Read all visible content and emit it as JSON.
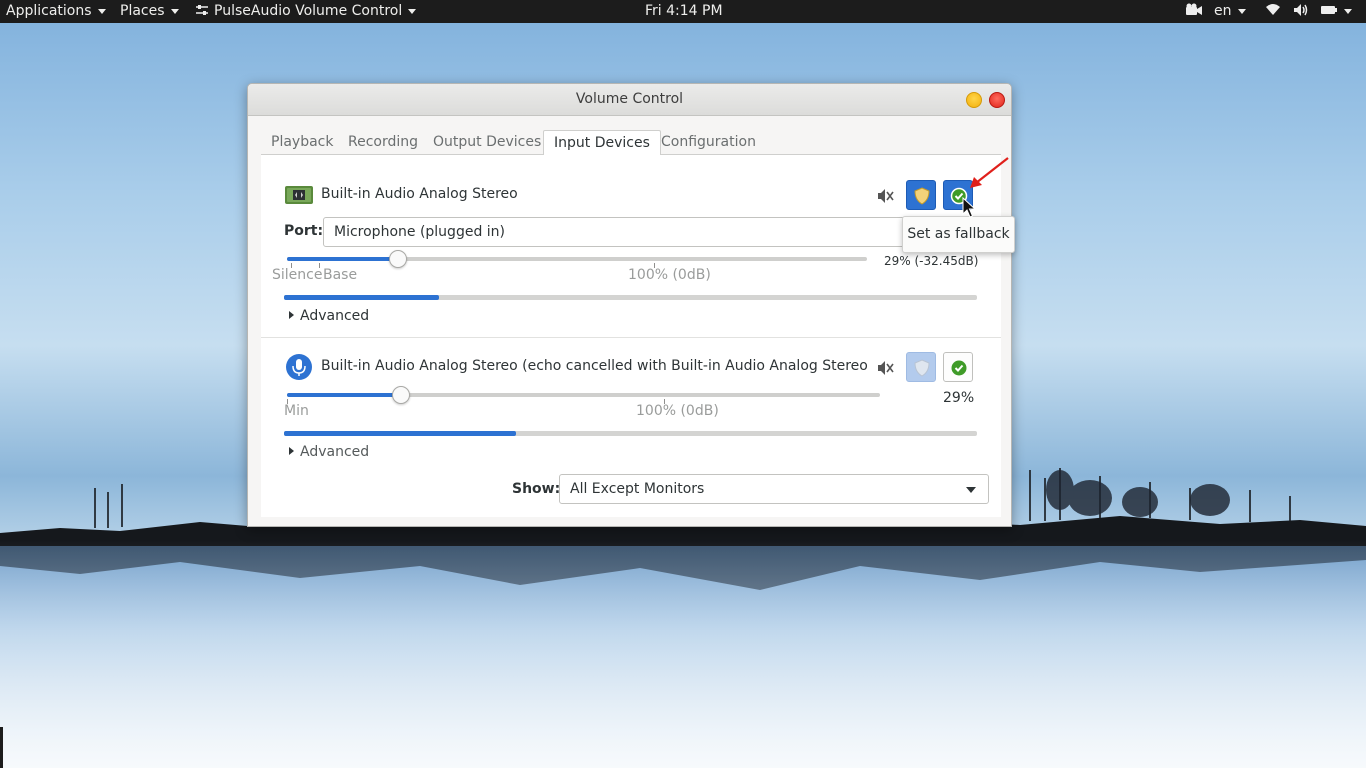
{
  "topbar": {
    "applications": "Applications",
    "places": "Places",
    "app_menu": "PulseAudio Volume Control",
    "clock": "Fri  4:14 PM",
    "language": "en"
  },
  "window": {
    "title": "Volume Control",
    "tabs": [
      "Playback",
      "Recording",
      "Output Devices",
      "Input Devices",
      "Configuration"
    ],
    "active_tab": "Input Devices"
  },
  "devices": [
    {
      "name": "Built-in Audio Analog Stereo",
      "port_label": "Port:",
      "port_value": "Microphone (plugged in)",
      "volume_label": "29% (-32.45dB)",
      "volume_fraction": 0.29,
      "mark_left": "Silence",
      "mark_base": "Base",
      "mark_100": "100% (0dB)",
      "level_fraction": 0.223,
      "advanced": "Advanced",
      "lock_active": true,
      "fallback_active": true
    },
    {
      "name": "Built-in Audio Analog Stereo (echo cancelled with Built-in Audio Analog Stereo)",
      "volume_label": "29%",
      "volume_fraction": 0.29,
      "mark_left": "Min",
      "mark_100": "100% (0dB)",
      "level_fraction": 0.335,
      "advanced": "Advanced",
      "lock_active": false,
      "fallback_active": false
    }
  ],
  "show": {
    "label": "Show:",
    "value": "All Except Monitors"
  },
  "tooltip": "Set as fallback",
  "colors": {
    "accent": "#2d72d2",
    "topbar": "#1c1c1c",
    "annotation_arrow": "#e0201b"
  }
}
